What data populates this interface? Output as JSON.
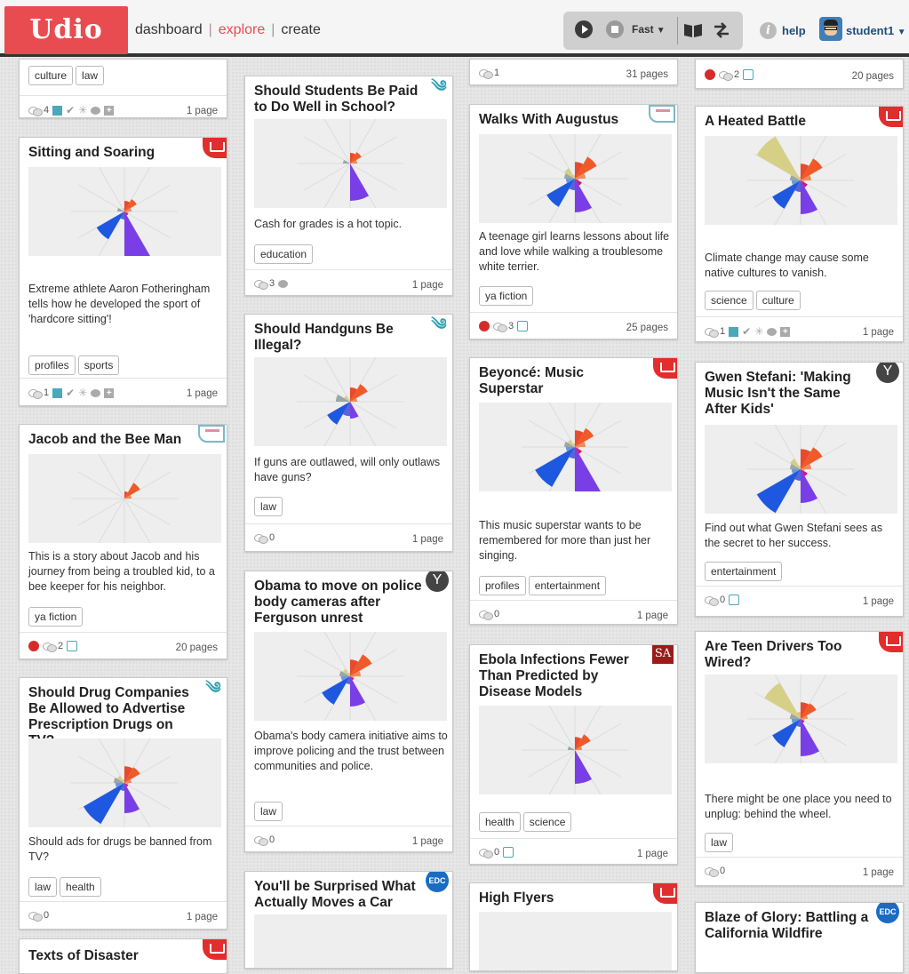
{
  "app": {
    "logo": "Udio",
    "nav": {
      "dashboard": "dashboard",
      "explore": "explore",
      "create": "create"
    },
    "speed": "Fast",
    "help": "help",
    "username": "student1",
    "accent_color": "#e84b50"
  },
  "cards": [
    {
      "id": "c1",
      "title": "",
      "desc": "",
      "tags": [
        "culture",
        "law"
      ],
      "footer": {
        "comments": "4",
        "indicators": [
          "square-filled",
          "check",
          "spark",
          "bubble",
          "plus"
        ],
        "pages": "1 page"
      },
      "badge": ""
    },
    {
      "id": "c2",
      "title": "Sitting and Soaring",
      "desc": "Extreme athlete Aaron Fotheringham tells how he developed the sport of 'hardcore sitting'!",
      "tags": [
        "profiles",
        "sports"
      ],
      "footer": {
        "comments": "1",
        "indicators": [
          "square-filled",
          "check",
          "spark",
          "bubble",
          "plus"
        ],
        "pages": "1 page"
      },
      "badge": "book"
    },
    {
      "id": "c3",
      "title": "Jacob and the Bee Man",
      "desc": "This is a story about Jacob and his journey from being a troubled kid, to a bee keeper for his neighbor.",
      "tags": [
        "ya fiction"
      ],
      "footer": {
        "apple": true,
        "comments": "2",
        "indicators": [
          "square-empty"
        ],
        "pages": "20 pages"
      },
      "badge": "flag"
    },
    {
      "id": "c4",
      "title": "Should Drug Companies Be Allowed to Advertise Prescription Drugs on TV?",
      "desc": "Should ads for drugs be banned from TV?",
      "tags": [
        "law",
        "health"
      ],
      "footer": {
        "comments": "0",
        "indicators": [],
        "pages": "1 page"
      },
      "badge": "swirl"
    },
    {
      "id": "c5",
      "title": "Texts of Disaster",
      "desc": "",
      "tags": [],
      "footer": null,
      "badge": "book"
    },
    {
      "id": "c6",
      "title": "Should Students Be Paid to Do Well in School?",
      "desc": "Cash for grades is a hot topic.",
      "tags": [
        "education"
      ],
      "footer": {
        "comments": "3",
        "indicators": [
          "bubble"
        ],
        "pages": "1 page"
      },
      "badge": "swirl"
    },
    {
      "id": "c7",
      "title": "Should Handguns Be Illegal?",
      "desc": "If guns are outlawed, will only outlaws have guns?",
      "tags": [
        "law"
      ],
      "footer": {
        "comments": "0",
        "indicators": [],
        "pages": "1 page"
      },
      "badge": "swirl"
    },
    {
      "id": "c8",
      "title": "Obama to move on police body cameras after Ferguson unrest",
      "desc": "Obama's body camera initiative aims to improve policing and the trust between communities and police.",
      "tags": [
        "law"
      ],
      "footer": {
        "comments": "0",
        "indicators": [],
        "pages": "1 page"
      },
      "badge": "Y"
    },
    {
      "id": "c9",
      "title": "You'll be Surprised What Actually Moves a Car",
      "desc": "",
      "tags": [],
      "footer": null,
      "badge": "EDC"
    },
    {
      "id": "c10",
      "title": "",
      "desc": "",
      "tags": [],
      "footer": {
        "comments": "1",
        "indicators": [],
        "pages": "31 pages"
      },
      "badge": ""
    },
    {
      "id": "c11",
      "title": "Walks With Augustus",
      "desc": "A teenage girl learns lessons about life and love while walking a troublesome white terrier.",
      "tags": [
        "ya fiction"
      ],
      "footer": {
        "apple": true,
        "comments": "3",
        "indicators": [
          "square-empty"
        ],
        "pages": "25 pages"
      },
      "badge": "flag"
    },
    {
      "id": "c12",
      "title": "Beyoncé: Music Superstar",
      "desc": "This music superstar wants to be remembered for more than just her singing.",
      "tags": [
        "profiles",
        "entertainment"
      ],
      "footer": {
        "comments": "0",
        "indicators": [],
        "pages": "1 page"
      },
      "badge": "book"
    },
    {
      "id": "c13",
      "title": "Ebola Infections Fewer Than Predicted by Disease Models",
      "desc": "",
      "tags": [
        "health",
        "science"
      ],
      "footer": {
        "comments": "0",
        "indicators": [
          "square-empty"
        ],
        "pages": "1 page"
      },
      "badge": "SA"
    },
    {
      "id": "c14",
      "title": "High Flyers",
      "desc": "",
      "tags": [],
      "footer": null,
      "badge": "book"
    },
    {
      "id": "c15",
      "title": "",
      "desc": "",
      "tags": [],
      "footer": {
        "apple": true,
        "comments": "2",
        "indicators": [
          "square-empty"
        ],
        "pages": "20 pages"
      },
      "badge": ""
    },
    {
      "id": "c16",
      "title": "A Heated Battle",
      "desc": "Climate change may cause some native cultures to vanish.",
      "tags": [
        "science",
        "culture"
      ],
      "footer": {
        "comments": "1",
        "indicators": [
          "square-filled",
          "check",
          "spark",
          "bubble",
          "plus"
        ],
        "pages": "1 page"
      },
      "badge": "book"
    },
    {
      "id": "c17",
      "title": "Gwen Stefani: 'Making Music Isn't the Same After Kids'",
      "desc": "Find out what Gwen Stefani sees as the secret to her success.",
      "tags": [
        "entertainment"
      ],
      "footer": {
        "comments": "0",
        "indicators": [
          "square-empty"
        ],
        "pages": "1 page"
      },
      "badge": "Y"
    },
    {
      "id": "c18",
      "title": "Are Teen Drivers Too Wired?",
      "desc": "There might be one place you need to unplug: behind the wheel.",
      "tags": [
        "law"
      ],
      "footer": {
        "comments": "0",
        "indicators": [],
        "pages": "1 page"
      },
      "badge": "book"
    },
    {
      "id": "c19",
      "title": "Blaze of Glory: Battling a California Wildfire",
      "desc": "",
      "tags": [],
      "footer": null,
      "badge": "EDC"
    }
  ],
  "charts": {
    "c2": [
      [
        3,
        0
      ],
      [
        4,
        0
      ],
      [
        2,
        0
      ],
      [
        1,
        1
      ],
      [
        1,
        2
      ],
      [
        6,
        80
      ],
      [
        1,
        9
      ],
      [
        6,
        22
      ],
      [
        0,
        0
      ],
      [
        2,
        0
      ],
      [
        0,
        0
      ],
      [
        1,
        0
      ]
    ],
    "c3": [
      [
        2,
        0
      ],
      [
        4,
        8
      ],
      [
        2,
        0
      ],
      [
        0,
        0
      ],
      [
        0,
        0
      ],
      [
        0,
        0
      ],
      [
        0,
        0
      ],
      [
        0,
        0
      ],
      [
        0,
        0
      ],
      [
        0,
        0
      ],
      [
        0,
        0
      ],
      [
        0,
        0
      ]
    ],
    "c4": [
      [
        4,
        5
      ],
      [
        4,
        8
      ],
      [
        2,
        0
      ],
      [
        1,
        1
      ],
      [
        1,
        2
      ],
      [
        3,
        40
      ],
      [
        1,
        9
      ],
      [
        3,
        75
      ],
      [
        2,
        4
      ],
      [
        3,
        0
      ],
      [
        2,
        3
      ],
      [
        1,
        0
      ]
    ],
    "c6": [
      [
        3,
        0
      ],
      [
        3,
        5
      ],
      [
        2,
        0
      ],
      [
        0,
        0
      ],
      [
        0,
        0
      ],
      [
        5,
        40
      ],
      [
        0,
        0
      ],
      [
        0,
        0
      ],
      [
        0,
        0
      ],
      [
        2,
        0
      ],
      [
        0,
        0
      ],
      [
        0,
        0
      ]
    ],
    "c7": [
      [
        4,
        0
      ],
      [
        5,
        5
      ],
      [
        2,
        0
      ],
      [
        0,
        0
      ],
      [
        0,
        0
      ],
      [
        2,
        20
      ],
      [
        2,
        15
      ],
      [
        4,
        25
      ],
      [
        0,
        0
      ],
      [
        4,
        0
      ],
      [
        2,
        0
      ],
      [
        0,
        0
      ]
    ],
    "c8": [
      [
        4,
        5
      ],
      [
        6,
        8
      ],
      [
        3,
        0
      ],
      [
        1,
        1
      ],
      [
        1,
        2
      ],
      [
        3,
        40
      ],
      [
        1,
        9
      ],
      [
        3,
        45
      ],
      [
        2,
        4
      ],
      [
        3,
        0
      ],
      [
        2,
        3
      ],
      [
        1,
        0
      ]
    ],
    "c11": [
      [
        4,
        5
      ],
      [
        6,
        8
      ],
      [
        3,
        0
      ],
      [
        1,
        1
      ],
      [
        2,
        2
      ],
      [
        4,
        40
      ],
      [
        2,
        9
      ],
      [
        3,
        45
      ],
      [
        2,
        4
      ],
      [
        3,
        0
      ],
      [
        3,
        3
      ],
      [
        1,
        0
      ]
    ],
    "c12": [
      [
        4,
        5
      ],
      [
        5,
        8
      ],
      [
        3,
        0
      ],
      [
        1,
        1
      ],
      [
        2,
        2
      ],
      [
        7,
        75
      ],
      [
        2,
        9
      ],
      [
        4,
        65
      ],
      [
        2,
        4
      ],
      [
        3,
        0
      ],
      [
        2,
        3
      ],
      [
        1,
        0
      ]
    ],
    "c13": [
      [
        3,
        5
      ],
      [
        4,
        8
      ],
      [
        2,
        0
      ],
      [
        0,
        0
      ],
      [
        0,
        0
      ],
      [
        4,
        40
      ],
      [
        0,
        0
      ],
      [
        0,
        0
      ],
      [
        0,
        0
      ],
      [
        2,
        0
      ],
      [
        0,
        0
      ],
      [
        0,
        0
      ]
    ],
    "c16": [
      [
        4,
        5
      ],
      [
        6,
        8
      ],
      [
        3,
        0
      ],
      [
        1,
        1
      ],
      [
        2,
        2
      ],
      [
        4,
        40
      ],
      [
        2,
        9
      ],
      [
        3,
        45
      ],
      [
        2,
        4
      ],
      [
        3,
        0
      ],
      [
        6,
        60
      ],
      [
        1,
        0
      ]
    ],
    "c17": [
      [
        5,
        5
      ],
      [
        6,
        8
      ],
      [
        3,
        0
      ],
      [
        1,
        1
      ],
      [
        2,
        2
      ],
      [
        4,
        40
      ],
      [
        2,
        9
      ],
      [
        8,
        45
      ],
      [
        2,
        4
      ],
      [
        3,
        0
      ],
      [
        3,
        3
      ],
      [
        1,
        0
      ]
    ],
    "c18": [
      [
        4,
        5
      ],
      [
        4,
        8
      ],
      [
        2,
        0
      ],
      [
        1,
        1
      ],
      [
        1,
        2
      ],
      [
        5,
        40
      ],
      [
        1,
        9
      ],
      [
        3,
        45
      ],
      [
        2,
        4
      ],
      [
        3,
        0
      ],
      [
        9,
        20
      ],
      [
        2,
        0
      ]
    ]
  },
  "palette": [
    "#e84a2e",
    "#f05a28",
    "#f08b5a",
    "#e8a070",
    "#d6127f",
    "#7a3ee6",
    "#5b62d8",
    "#1e58e0",
    "#6a9ad8",
    "#9aa6a8",
    "#d6cf86",
    "#e8b890"
  ]
}
